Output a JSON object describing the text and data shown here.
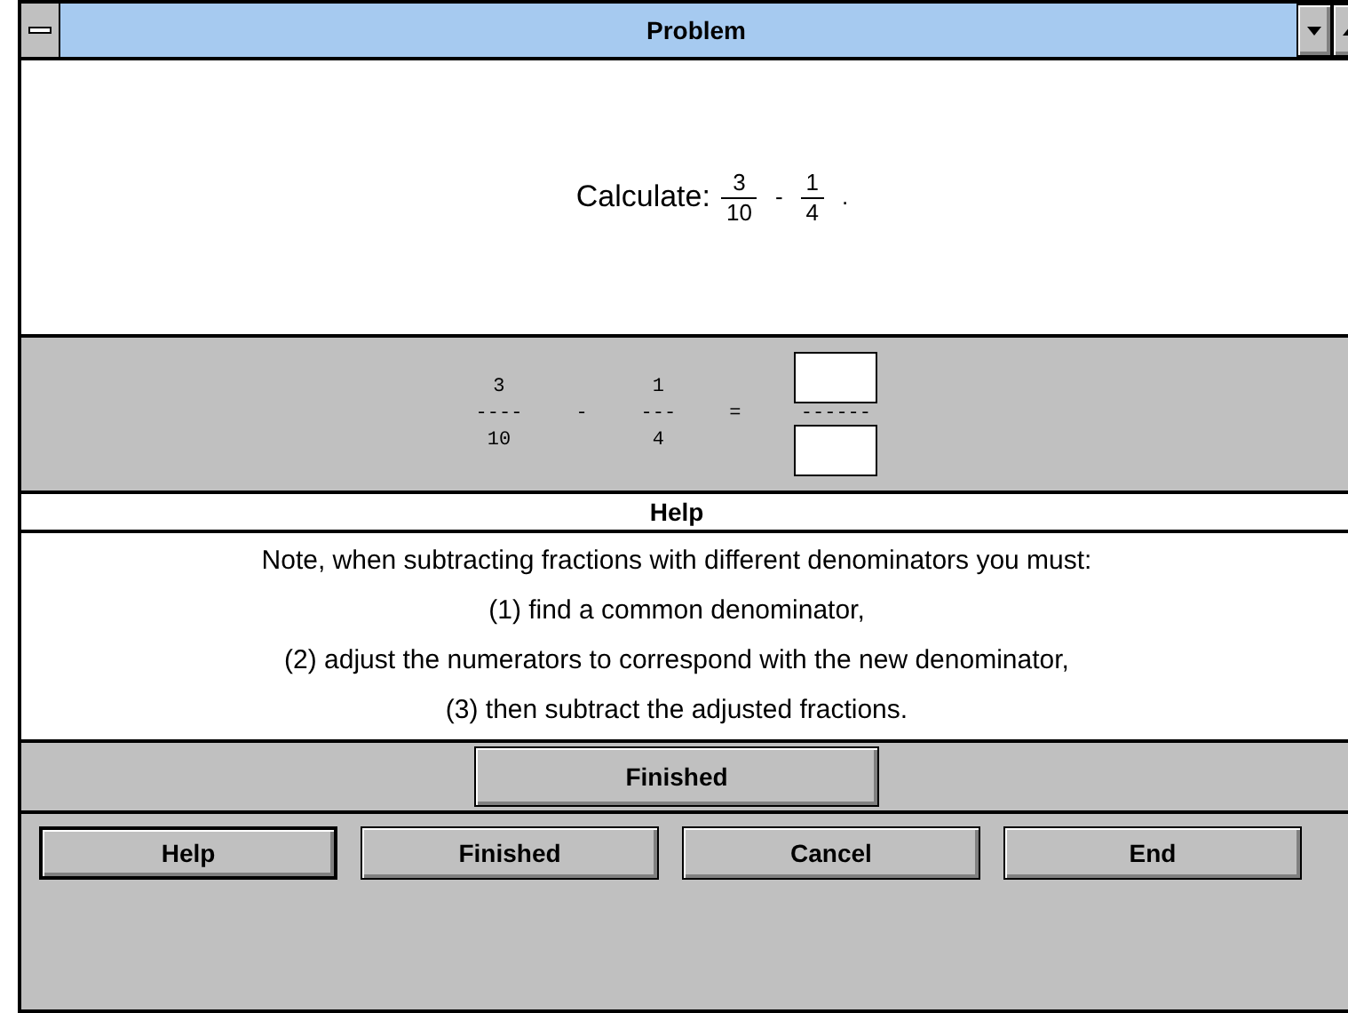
{
  "window": {
    "title": "Problem"
  },
  "problem": {
    "label": "Calculate:",
    "fractions": [
      {
        "numerator": "3",
        "denominator": "10"
      },
      {
        "numerator": "1",
        "denominator": "4"
      }
    ],
    "operator": "-",
    "end": "."
  },
  "work": {
    "terms": [
      {
        "numerator": "3",
        "bar": "----",
        "denominator": "10"
      },
      {
        "numerator": "1",
        "bar": "---",
        "denominator": "4"
      }
    ],
    "operator": "-",
    "equals": "=",
    "answer_bar": "------"
  },
  "help": {
    "title": "Help",
    "lines": [
      "Note, when subtracting fractions with different denominators you must:",
      "(1) find a common denominator,",
      "(2) adjust the numerators to correspond with the new denominator,",
      "(3) then subtract the adjusted fractions."
    ]
  },
  "finish_button": "Finished",
  "buttons": [
    {
      "label": "Help",
      "default": true
    },
    {
      "label": "Finished",
      "default": false
    },
    {
      "label": "Cancel",
      "default": false
    },
    {
      "label": "End",
      "default": false
    }
  ]
}
